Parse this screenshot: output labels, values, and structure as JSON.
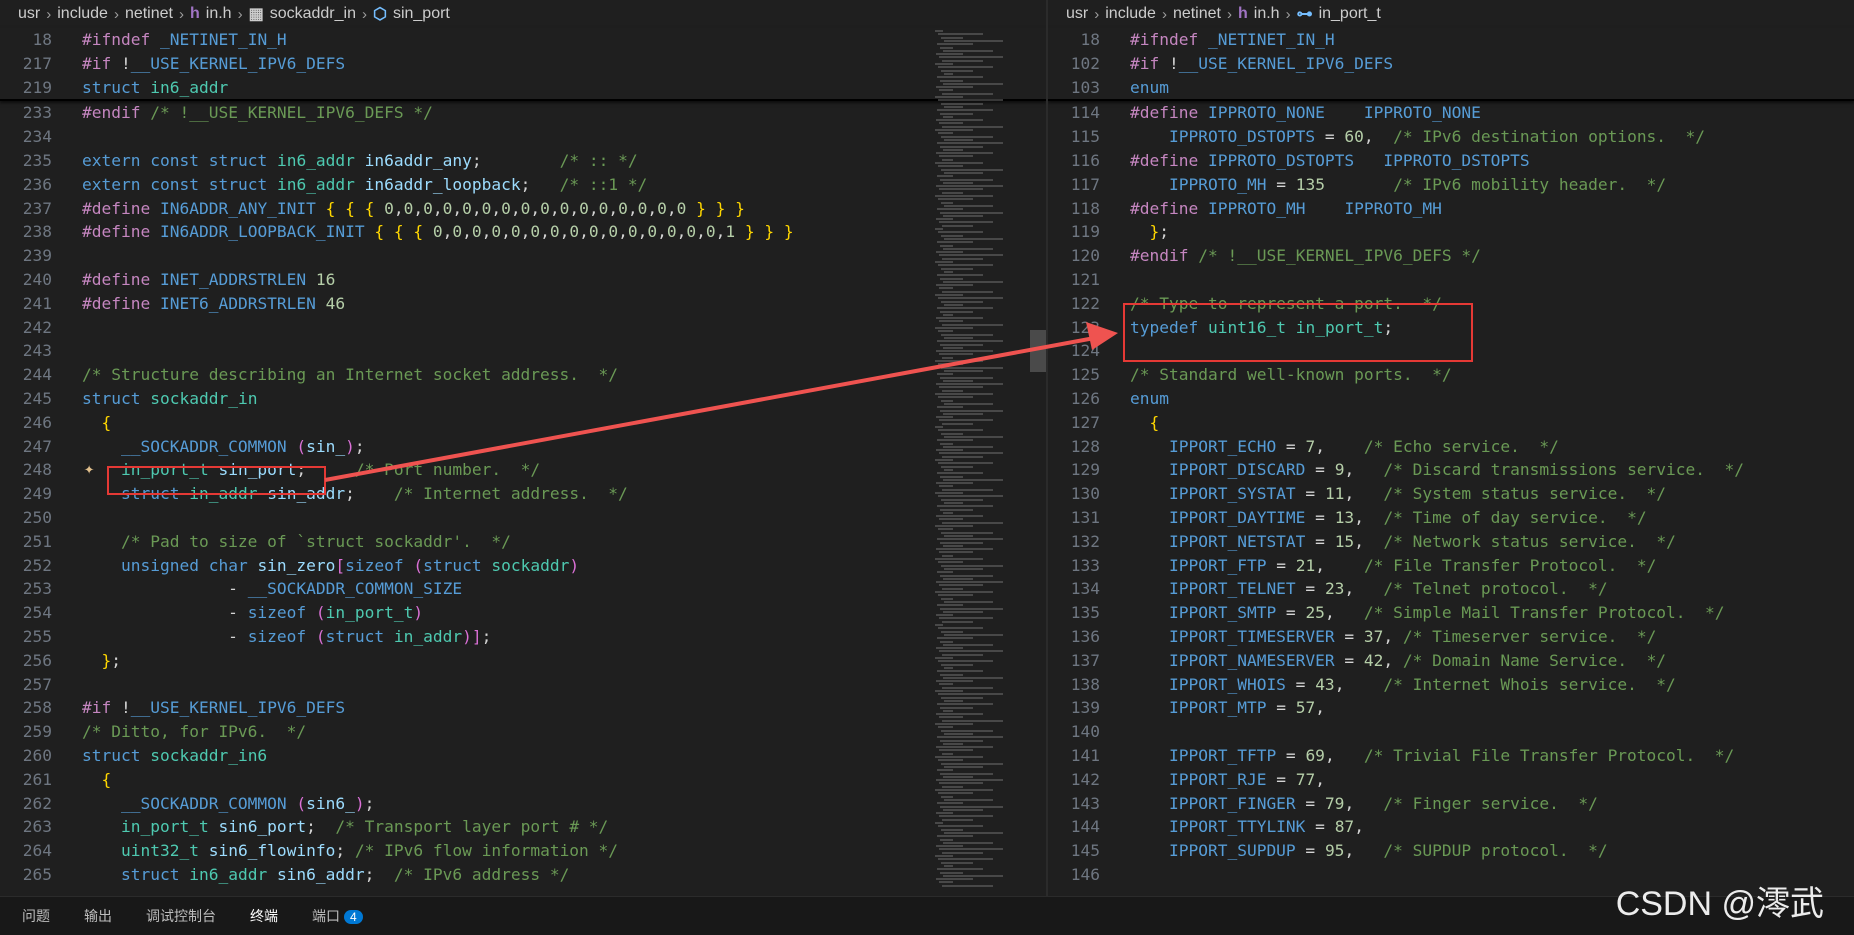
{
  "left": {
    "breadcrumb": [
      "usr",
      "include",
      "netinet",
      "in.h",
      "sockaddr_in",
      "sin_port"
    ],
    "breadcrumb_icons": [
      "h-file-icon",
      "struct-icon",
      "field-icon"
    ],
    "sticky": [
      {
        "ln": "18",
        "text": "#ifndef _NETINET_IN_H"
      },
      {
        "ln": "217",
        "text": "#if !__USE_KERNEL_IPV6_DEFS"
      },
      {
        "ln": "219",
        "text": "struct in6_addr"
      }
    ],
    "lines": [
      {
        "ln": "233",
        "text": "#endif /* !__USE_KERNEL_IPV6_DEFS */"
      },
      {
        "ln": "234",
        "text": ""
      },
      {
        "ln": "235",
        "text": "extern const struct in6_addr in6addr_any;        /* :: */"
      },
      {
        "ln": "236",
        "text": "extern const struct in6_addr in6addr_loopback;   /* ::1 */"
      },
      {
        "ln": "237",
        "text": "#define IN6ADDR_ANY_INIT { { { 0,0,0,0,0,0,0,0,0,0,0,0,0,0,0,0 } } }"
      },
      {
        "ln": "238",
        "text": "#define IN6ADDR_LOOPBACK_INIT { { { 0,0,0,0,0,0,0,0,0,0,0,0,0,0,0,1 } } }"
      },
      {
        "ln": "239",
        "text": ""
      },
      {
        "ln": "240",
        "text": "#define INET_ADDRSTRLEN 16"
      },
      {
        "ln": "241",
        "text": "#define INET6_ADDRSTRLEN 46"
      },
      {
        "ln": "242",
        "text": ""
      },
      {
        "ln": "243",
        "text": ""
      },
      {
        "ln": "244",
        "text": "/* Structure describing an Internet socket address.  */"
      },
      {
        "ln": "245",
        "text": "struct sockaddr_in"
      },
      {
        "ln": "246",
        "text": "  {"
      },
      {
        "ln": "247",
        "text": "    __SOCKADDR_COMMON (sin_);"
      },
      {
        "ln": "248",
        "text": "    in_port_t sin_port;     /* Port number.  */"
      },
      {
        "ln": "249",
        "text": "    struct in_addr sin_addr;    /* Internet address.  */"
      },
      {
        "ln": "250",
        "text": ""
      },
      {
        "ln": "251",
        "text": "    /* Pad to size of `struct sockaddr'.  */"
      },
      {
        "ln": "252",
        "text": "    unsigned char sin_zero[sizeof (struct sockaddr)"
      },
      {
        "ln": "253",
        "text": "               - __SOCKADDR_COMMON_SIZE"
      },
      {
        "ln": "254",
        "text": "               - sizeof (in_port_t)"
      },
      {
        "ln": "255",
        "text": "               - sizeof (struct in_addr)];"
      },
      {
        "ln": "256",
        "text": "  };"
      },
      {
        "ln": "257",
        "text": ""
      },
      {
        "ln": "258",
        "text": "#if !__USE_KERNEL_IPV6_DEFS"
      },
      {
        "ln": "259",
        "text": "/* Ditto, for IPv6.  */"
      },
      {
        "ln": "260",
        "text": "struct sockaddr_in6"
      },
      {
        "ln": "261",
        "text": "  {"
      },
      {
        "ln": "262",
        "text": "    __SOCKADDR_COMMON (sin6_);"
      },
      {
        "ln": "263",
        "text": "    in_port_t sin6_port;  /* Transport layer port # */"
      },
      {
        "ln": "264",
        "text": "    uint32_t sin6_flowinfo; /* IPv6 flow information */"
      },
      {
        "ln": "265",
        "text": "    struct in6_addr sin6_addr;  /* IPv6 address */"
      }
    ]
  },
  "right": {
    "breadcrumb": [
      "usr",
      "include",
      "netinet",
      "in.h",
      "in_port_t"
    ],
    "breadcrumb_icons": [
      "h-file-icon",
      "typedef-icon"
    ],
    "sticky": [
      {
        "ln": "18",
        "text": "#ifndef _NETINET_IN_H"
      },
      {
        "ln": "102",
        "text": "#if !__USE_KERNEL_IPV6_DEFS"
      },
      {
        "ln": "103",
        "text": "enum"
      }
    ],
    "lines": [
      {
        "ln": "114",
        "text": "#define IPPROTO_NONE    IPPROTO_NONE"
      },
      {
        "ln": "115",
        "text": "    IPPROTO_DSTOPTS = 60,  /* IPv6 destination options.  */"
      },
      {
        "ln": "116",
        "text": "#define IPPROTO_DSTOPTS   IPPROTO_DSTOPTS"
      },
      {
        "ln": "117",
        "text": "    IPPROTO_MH = 135       /* IPv6 mobility header.  */"
      },
      {
        "ln": "118",
        "text": "#define IPPROTO_MH    IPPROTO_MH"
      },
      {
        "ln": "119",
        "text": "  };"
      },
      {
        "ln": "120",
        "text": "#endif /* !__USE_KERNEL_IPV6_DEFS */"
      },
      {
        "ln": "121",
        "text": ""
      },
      {
        "ln": "122",
        "text": "/* Type to represent a port.  */"
      },
      {
        "ln": "123",
        "text": "typedef uint16_t in_port_t;"
      },
      {
        "ln": "124",
        "text": ""
      },
      {
        "ln": "125",
        "text": "/* Standard well-known ports.  */"
      },
      {
        "ln": "126",
        "text": "enum"
      },
      {
        "ln": "127",
        "text": "  {"
      },
      {
        "ln": "128",
        "text": "    IPPORT_ECHO = 7,    /* Echo service.  */"
      },
      {
        "ln": "129",
        "text": "    IPPORT_DISCARD = 9,   /* Discard transmissions service.  */"
      },
      {
        "ln": "130",
        "text": "    IPPORT_SYSTAT = 11,   /* System status service.  */"
      },
      {
        "ln": "131",
        "text": "    IPPORT_DAYTIME = 13,  /* Time of day service.  */"
      },
      {
        "ln": "132",
        "text": "    IPPORT_NETSTAT = 15,  /* Network status service.  */"
      },
      {
        "ln": "133",
        "text": "    IPPORT_FTP = 21,    /* File Transfer Protocol.  */"
      },
      {
        "ln": "134",
        "text": "    IPPORT_TELNET = 23,   /* Telnet protocol.  */"
      },
      {
        "ln": "135",
        "text": "    IPPORT_SMTP = 25,   /* Simple Mail Transfer Protocol.  */"
      },
      {
        "ln": "136",
        "text": "    IPPORT_TIMESERVER = 37, /* Timeserver service.  */"
      },
      {
        "ln": "137",
        "text": "    IPPORT_NAMESERVER = 42, /* Domain Name Service.  */"
      },
      {
        "ln": "138",
        "text": "    IPPORT_WHOIS = 43,    /* Internet Whois service.  */"
      },
      {
        "ln": "139",
        "text": "    IPPORT_MTP = 57,"
      },
      {
        "ln": "140",
        "text": ""
      },
      {
        "ln": "141",
        "text": "    IPPORT_TFTP = 69,   /* Trivial File Transfer Protocol.  */"
      },
      {
        "ln": "142",
        "text": "    IPPORT_RJE = 77,"
      },
      {
        "ln": "143",
        "text": "    IPPORT_FINGER = 79,   /* Finger service.  */"
      },
      {
        "ln": "144",
        "text": "    IPPORT_TTYLINK = 87,"
      },
      {
        "ln": "145",
        "text": "    IPPORT_SUPDUP = 95,   /* SUPDUP protocol.  */"
      },
      {
        "ln": "146",
        "text": ""
      }
    ]
  },
  "panel_tabs": [
    {
      "label": "问题",
      "badge": ""
    },
    {
      "label": "输出",
      "badge": ""
    },
    {
      "label": "调试控制台",
      "badge": ""
    },
    {
      "label": "终端",
      "badge": ""
    },
    {
      "label": "端口",
      "badge": "4"
    }
  ],
  "active_tab": "终端",
  "watermark": "CSDN @澪武",
  "colors": {
    "background": "#1f1f1f",
    "keyword": "#569cd6",
    "preprocessor": "#c586c0",
    "type": "#4ec9b0",
    "variable": "#9cdcfe",
    "comment": "#6a9955",
    "annotation": "#e53935"
  }
}
